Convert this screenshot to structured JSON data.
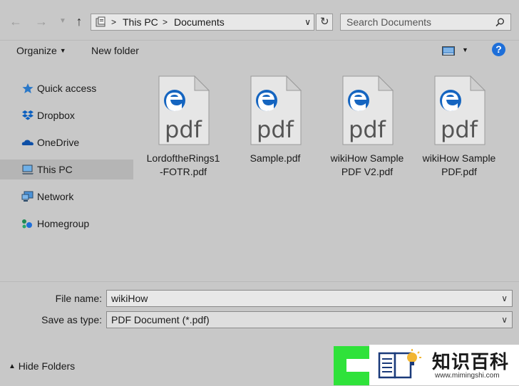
{
  "address": {
    "crumbs": [
      "This PC",
      "Documents"
    ],
    "search_placeholder": "Search Documents"
  },
  "toolbar": {
    "organize_label": "Organize",
    "new_folder_label": "New folder",
    "help_label": "?"
  },
  "sidebar": {
    "items": [
      {
        "label": "Quick access",
        "icon": "star-icon"
      },
      {
        "label": "Dropbox",
        "icon": "dropbox-icon"
      },
      {
        "label": "OneDrive",
        "icon": "cloud-icon"
      },
      {
        "label": "This PC",
        "icon": "computer-icon",
        "selected": true
      },
      {
        "label": "Network",
        "icon": "network-icon"
      },
      {
        "label": "Homegroup",
        "icon": "homegroup-icon"
      }
    ]
  },
  "files": [
    {
      "name_line1": "LordoftheRings1",
      "name_line2": "-FOTR.pdf",
      "icon_text": "pdf"
    },
    {
      "name_line1": "Sample.pdf",
      "name_line2": "",
      "icon_text": "pdf"
    },
    {
      "name_line1": "wikiHow Sample",
      "name_line2": "PDF V2.pdf",
      "icon_text": "pdf"
    },
    {
      "name_line1": "wikiHow Sample",
      "name_line2": "PDF.pdf",
      "icon_text": "pdf"
    }
  ],
  "form": {
    "file_name_label": "File name:",
    "file_name_value": "wikiHow",
    "save_type_label": "Save as type:",
    "save_type_value": "PDF Document (*.pdf)"
  },
  "footer": {
    "hide_folders_label": "Hide Folders"
  },
  "watermark": {
    "text": "知识百科",
    "url": "www.mimingshi.com"
  },
  "colors": {
    "accent_green": "#2fe23a",
    "edge_blue": "#1565c0",
    "help_blue": "#1e6fd9"
  }
}
